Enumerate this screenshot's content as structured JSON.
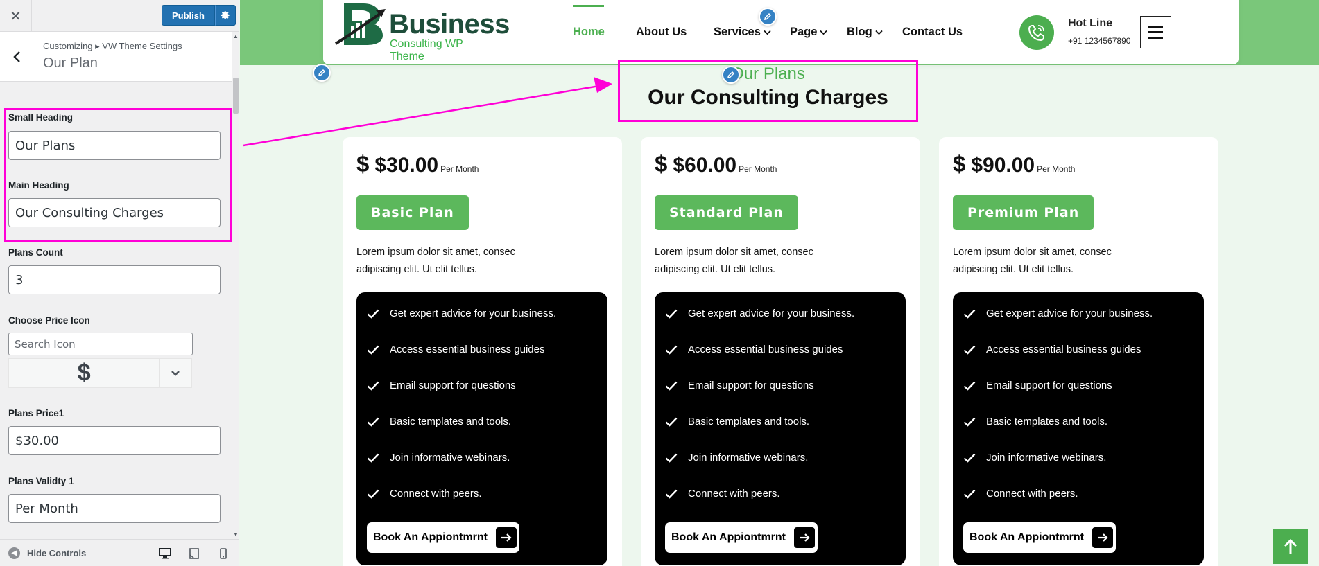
{
  "customizer": {
    "close_symbol": "✕",
    "publish_label": "Publish",
    "breadcrumb": "Customizing ▸ VW Theme Settings",
    "panel_title": "Our Plan",
    "fields": {
      "small_heading": {
        "label": "Small Heading",
        "value": "Our Plans"
      },
      "main_heading": {
        "label": "Main Heading",
        "value": "Our Consulting Charges"
      },
      "plans_count": {
        "label": "Plans Count",
        "value": "3"
      },
      "price_icon": {
        "label": "Choose Price Icon",
        "placeholder": "Search Icon",
        "preview": "$"
      },
      "plans_price1": {
        "label": "Plans Price1",
        "value": "$30.00"
      },
      "plans_validity1": {
        "label": "Plans Validty 1",
        "value": "Per Month"
      }
    },
    "hide_controls": "Hide Controls"
  },
  "site": {
    "logo_text": "Business",
    "logo_sub": "Consulting WP Theme",
    "nav": [
      {
        "label": "Home"
      },
      {
        "label": "About Us"
      },
      {
        "label": "Services"
      },
      {
        "label": "Page"
      },
      {
        "label": "Blog"
      },
      {
        "label": "Contact Us"
      }
    ],
    "hotline_title": "Hot Line",
    "hotline_number": "+91 1234567890",
    "section": {
      "small_heading": "Our Plans",
      "main_heading": "Our Consulting Charges"
    },
    "plans": [
      {
        "icon": "$",
        "price": "$30.00",
        "validity": "Per Month",
        "name": "Basic Plan",
        "desc": "Lorem ipsum dolor sit amet, consec adipiscing elit. Ut elit tellus.",
        "features": [
          "Get expert advice for your business.",
          "Access essential business guides",
          "Email support for questions",
          "Basic templates and tools.",
          "Join informative webinars.",
          "Connect with peers."
        ],
        "cta": "Book An Appiontmrnt"
      },
      {
        "icon": "$",
        "price": "$60.00",
        "validity": "Per Month",
        "name": "Standard Plan",
        "desc": "Lorem ipsum dolor sit amet, consec adipiscing elit. Ut elit tellus.",
        "features": [
          "Get expert advice for your business.",
          "Access essential business guides",
          "Email support for questions",
          "Basic templates and tools.",
          "Join informative webinars.",
          "Connect with peers."
        ],
        "cta": "Book An Appiontmrnt"
      },
      {
        "icon": "$",
        "price": "$90.00",
        "validity": "Per Month",
        "name": "Premium Plan",
        "desc": "Lorem ipsum dolor sit amet, consec adipiscing elit. Ut elit tellus.",
        "features": [
          "Get expert advice for your business.",
          "Access essential business guides",
          "Email support for questions",
          "Basic templates and tools.",
          "Join informative webinars.",
          "Connect with peers."
        ],
        "cta": "Book An Appiontmrnt"
      }
    ]
  },
  "colors": {
    "accent_green": "#4caf50",
    "header_band": "#7ac77a",
    "wp_blue": "#2271b1",
    "highlight_magenta": "#ff00d7"
  }
}
